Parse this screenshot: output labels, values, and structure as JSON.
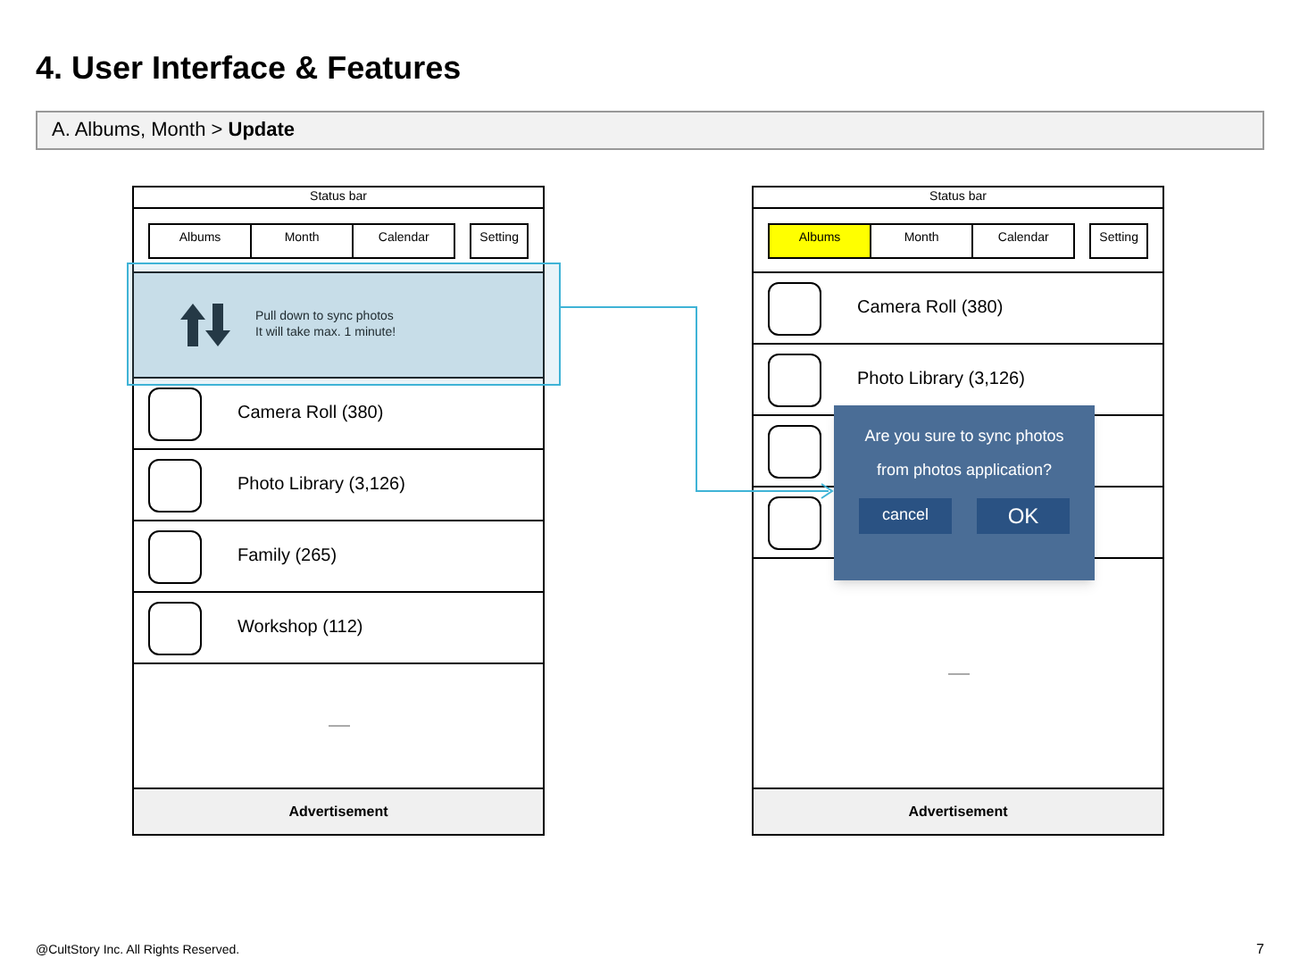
{
  "title": "4. User Interface & Features",
  "breadcrumb": "A. Albums, Month > **Update**",
  "screens": [
    {
      "status_bar": "Status bar",
      "tabs": [
        {
          "label": "Albums",
          "selected": false
        },
        {
          "label": "Month",
          "selected": false
        },
        {
          "label": "Calendar",
          "selected": false
        }
      ],
      "setting": "Setting",
      "sync_banner": {
        "lines": [
          "Pull down to sync photos",
          "It will take max. 1 minute!"
        ]
      },
      "albums": [
        {
          "kind": "album",
          "label": "Camera Roll (380)"
        },
        {
          "kind": "album",
          "label": "Photo Library (3,126)"
        },
        {
          "kind": "album",
          "label": "Family (265)"
        },
        {
          "kind": "album",
          "label": "Workshop (112)"
        }
      ],
      "advertisement": "Advertisement"
    },
    {
      "status_bar": "Status bar",
      "tabs": [
        {
          "label": "Albums",
          "selected": true
        },
        {
          "label": "Month",
          "selected": false
        },
        {
          "label": "Calendar",
          "selected": false
        }
      ],
      "setting": "Setting",
      "albums": [
        {
          "kind": "album",
          "label": "Camera Roll (380)"
        },
        {
          "kind": "album",
          "label": "Photo Library (3,126)"
        },
        {
          "kind": "covered"
        },
        {
          "kind": "covered"
        }
      ],
      "dialog": {
        "message_lines": [
          "Are you sure to sync photos",
          "from photos application?"
        ],
        "buttons": [
          "cancel",
          "OK"
        ]
      },
      "advertisement": "Advertisement"
    }
  ],
  "footer": {
    "copyright": "@CultStory Inc. All Rights Reserved.",
    "page_number": "7"
  }
}
